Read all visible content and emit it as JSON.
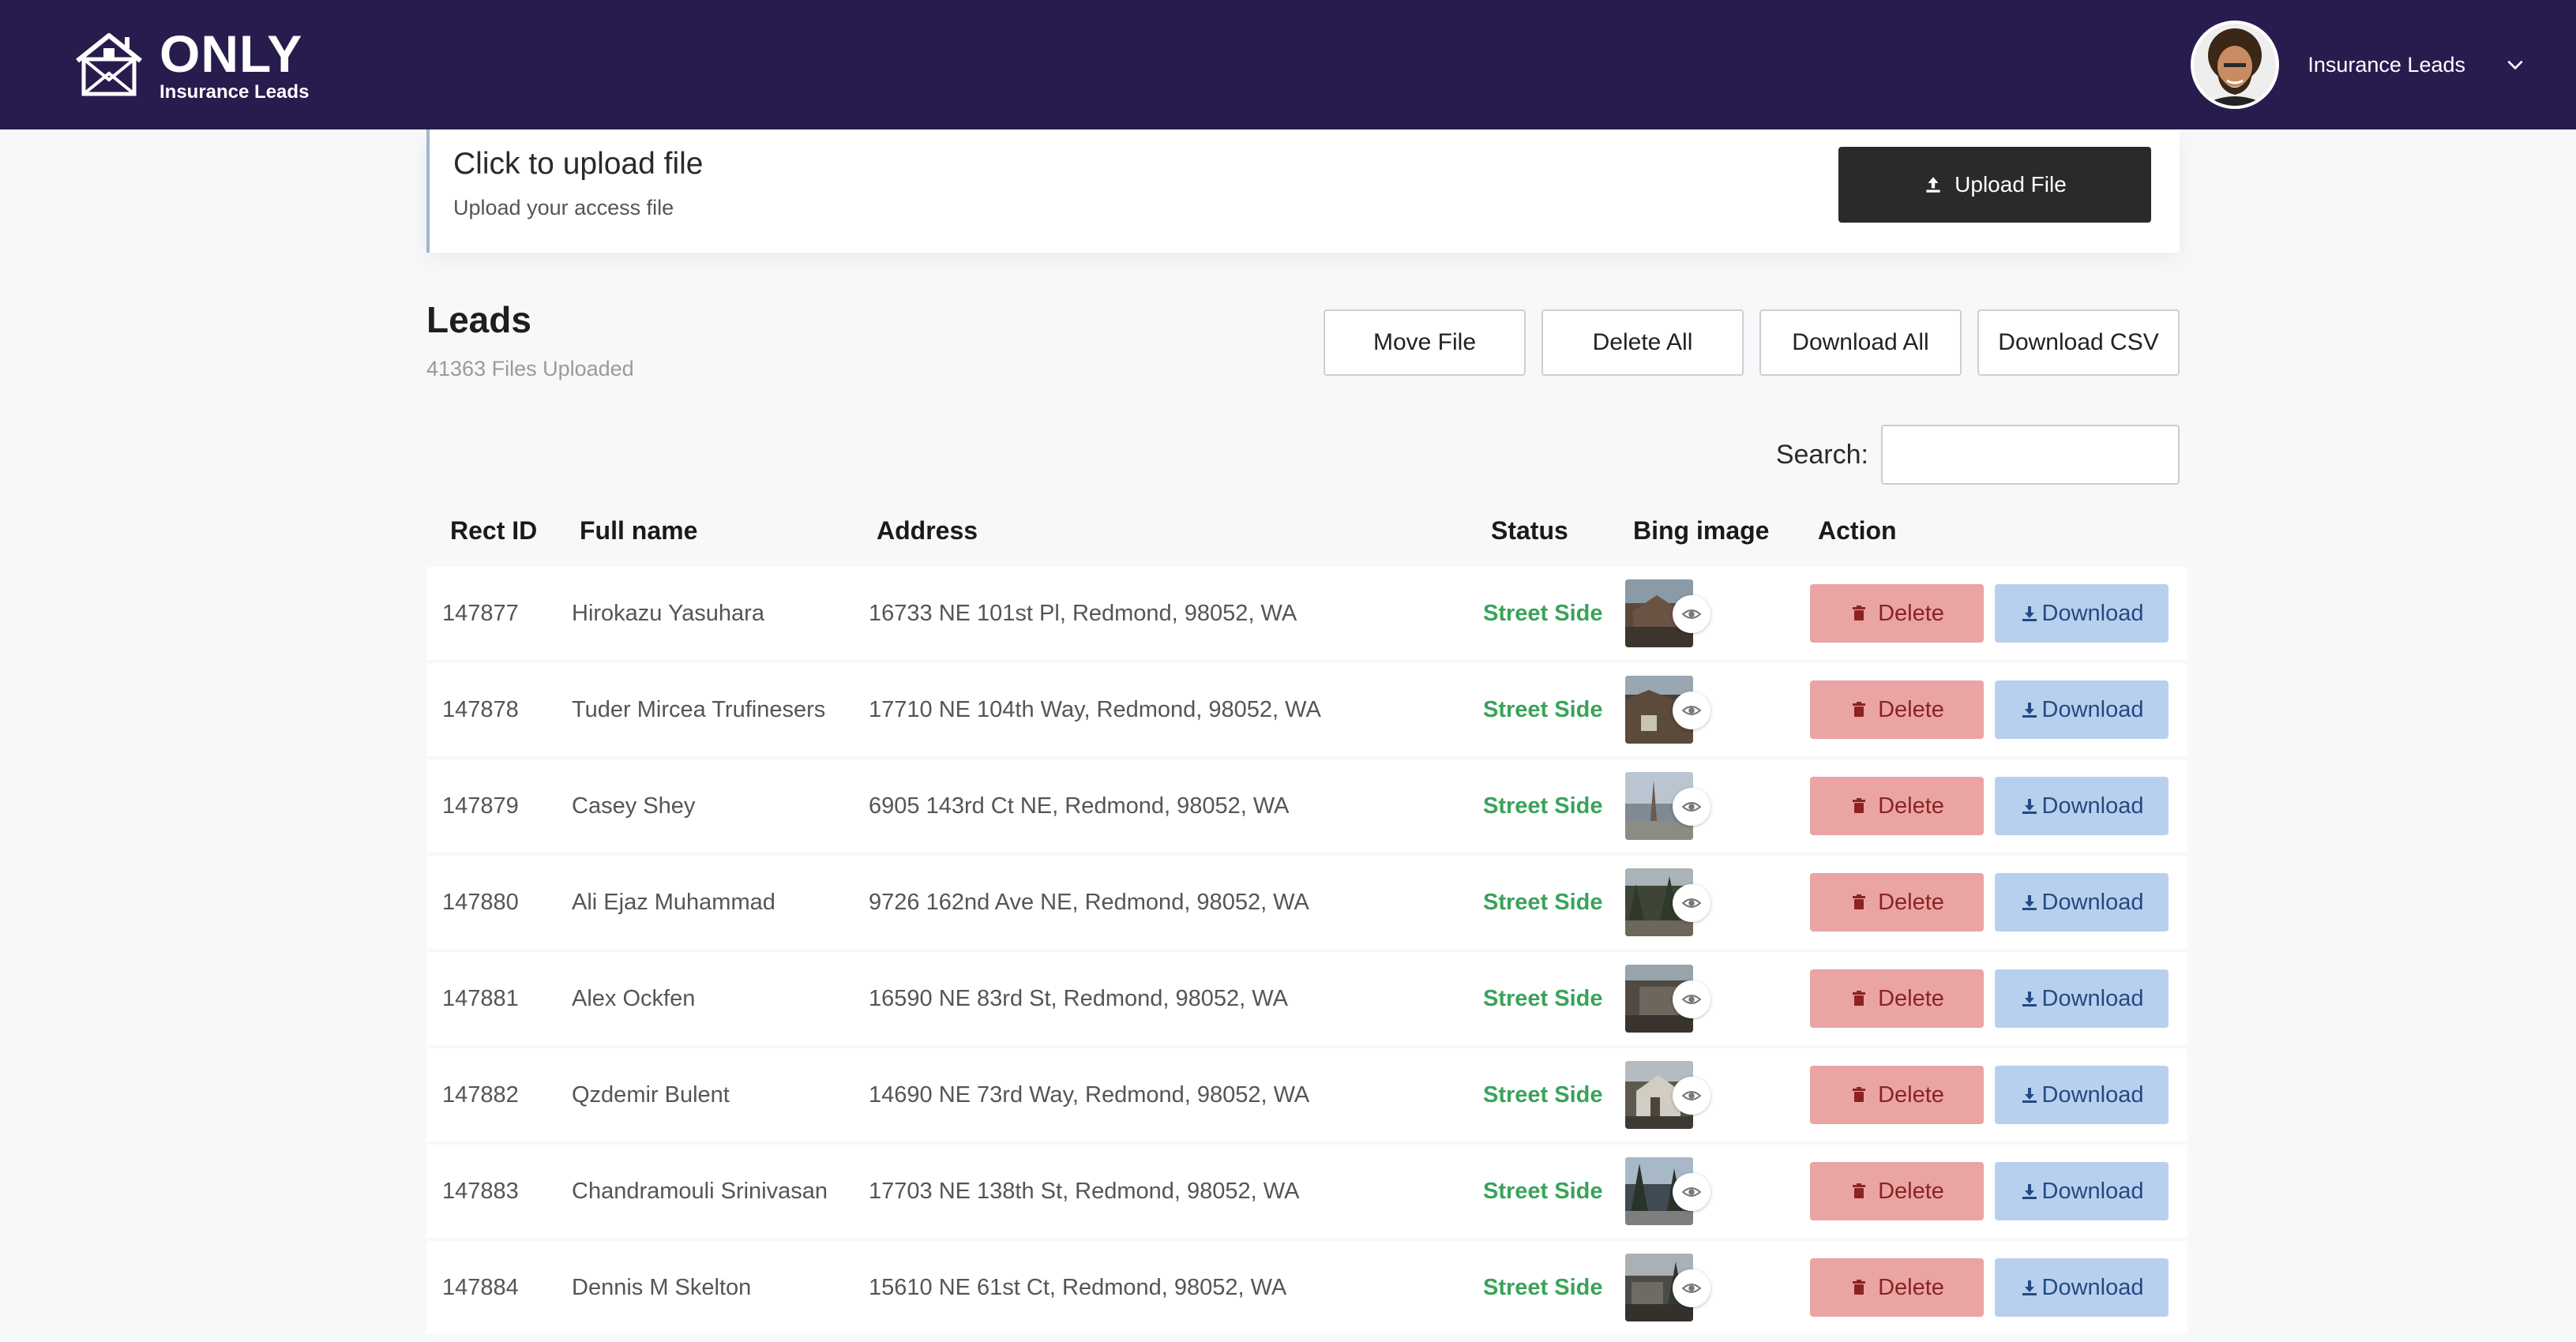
{
  "header": {
    "brand_name": "ONLY",
    "brand_sub": "Insurance Leads",
    "user_name": "Insurance Leads",
    "bg_color": "#281c4e"
  },
  "upload": {
    "title": "Click to upload file",
    "subtitle": "Upload your access file",
    "button_label": "Upload File"
  },
  "leads": {
    "title": "Leads",
    "count_text": "41363 Files Uploaded",
    "buttons": [
      "Move File",
      "Delete All",
      "Download All",
      "Download CSV"
    ]
  },
  "search": {
    "label": "Search:",
    "value": ""
  },
  "table": {
    "columns": [
      "Rect ID",
      "Full name",
      "Address",
      "Status",
      "Bing image",
      "Action"
    ],
    "delete_label": "Delete",
    "download_label": "Download",
    "status_color": "#3aa35a",
    "rows": [
      {
        "id": "147877",
        "name": "Hirokazu Yasuhara",
        "address": "16733 NE 101st Pl, Redmond, 98052, WA",
        "status": "Street Side"
      },
      {
        "id": "147878",
        "name": "Tuder Mircea Trufinesers",
        "address": "17710 NE 104th Way, Redmond, 98052, WA",
        "status": "Street Side"
      },
      {
        "id": "147879",
        "name": "Casey Shey",
        "address": "6905 143rd Ct NE, Redmond, 98052, WA",
        "status": "Street Side"
      },
      {
        "id": "147880",
        "name": "Ali Ejaz Muhammad",
        "address": "9726 162nd Ave NE, Redmond, 98052, WA",
        "status": "Street Side"
      },
      {
        "id": "147881",
        "name": "Alex Ockfen",
        "address": "16590 NE 83rd St, Redmond, 98052, WA",
        "status": "Street Side"
      },
      {
        "id": "147882",
        "name": "Qzdemir Bulent",
        "address": "14690 NE 73rd Way, Redmond, 98052, WA",
        "status": "Street Side"
      },
      {
        "id": "147883",
        "name": "Chandramouli Srinivasan",
        "address": "17703 NE 138th St, Redmond, 98052, WA",
        "status": "Street Side"
      },
      {
        "id": "147884",
        "name": "Dennis M Skelton",
        "address": "15610 NE 61st Ct, Redmond, 98052, WA",
        "status": "Street Side"
      }
    ]
  }
}
